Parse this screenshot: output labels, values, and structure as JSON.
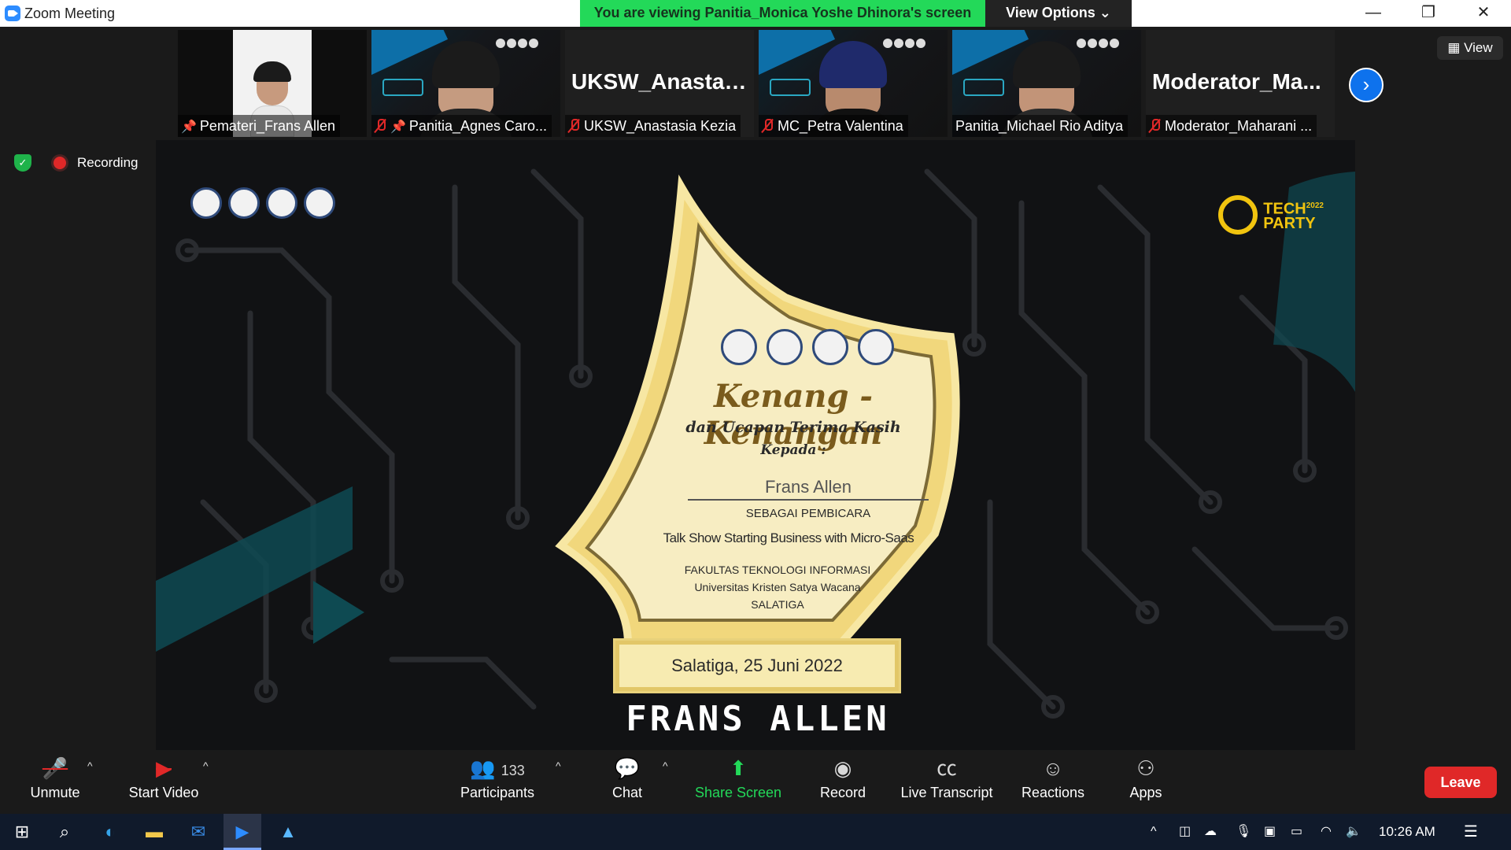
{
  "window": {
    "title": "Zoom Meeting"
  },
  "banner": {
    "sharing_text": "You are viewing Panitia_Monica Yoshe Dhinora's screen",
    "view_options_label": "View Options ⌄"
  },
  "window_controls": {
    "minimize": "—",
    "restore": "❐",
    "close": "✕"
  },
  "participants_strip": [
    {
      "name": "Pemateri_Frans Allen",
      "big_name": "",
      "muted": false,
      "pinned": true,
      "video": true
    },
    {
      "name": "Panitia_Agnes Caro...",
      "big_name": "",
      "muted": true,
      "pinned": true,
      "video": true
    },
    {
      "name": "UKSW_Anastasia Kezia",
      "big_name": "UKSW_Anastasi...",
      "muted": true,
      "pinned": false,
      "video": false
    },
    {
      "name": "MC_Petra Valentina",
      "big_name": "",
      "muted": true,
      "pinned": false,
      "video": true
    },
    {
      "name": "Panitia_Michael Rio Aditya",
      "big_name": "",
      "muted": false,
      "pinned": false,
      "video": true,
      "active_speaker": true
    },
    {
      "name": "Moderator_Maharani ...",
      "big_name": "Moderator_Ma...",
      "muted": true,
      "pinned": false,
      "video": false
    }
  ],
  "view_button": {
    "label": "View"
  },
  "recording": {
    "label": "Recording"
  },
  "shared_screen": {
    "certificate": {
      "title": "Kenang - Kenangan",
      "subtitle": "dan Ucapan Terima Kasih",
      "kepada": "Kepada :",
      "recipient": "Frans Allen",
      "role": "SEBAGAI PEMBICARA",
      "event": "Talk Show Starting Business with Micro-Saas",
      "faculty": "FAKULTAS TEKNOLOGI INFORMASI",
      "university": "Universitas Kristen Satya Wacana",
      "city": "SALATIGA",
      "date": "Salatiga, 25 Juni 2022"
    },
    "banner_name": "FRANS ALLEN",
    "event_logo": {
      "line1": "TECH",
      "line2": "PARTY",
      "year": "2022"
    }
  },
  "toolbar": {
    "unmute": "Unmute",
    "start_video": "Start Video",
    "participants": "Participants",
    "participant_count": "133",
    "chat": "Chat",
    "share_screen": "Share Screen",
    "record": "Record",
    "live_transcript": "Live Transcript",
    "reactions": "Reactions",
    "apps": "Apps",
    "leave": "Leave"
  },
  "taskbar": {
    "time": "10:26 AM"
  },
  "colors": {
    "zoom_blue": "#0e72ed",
    "share_green": "#23d959",
    "leave_red": "#e02828",
    "gold": "#f1d77c"
  }
}
